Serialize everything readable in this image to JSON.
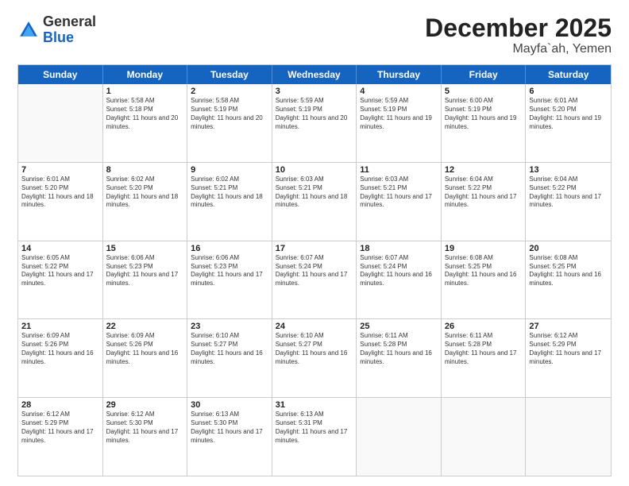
{
  "header": {
    "logo_general": "General",
    "logo_blue": "Blue",
    "month_title": "December 2025",
    "location": "Mayfa`ah, Yemen"
  },
  "calendar": {
    "days_of_week": [
      "Sunday",
      "Monday",
      "Tuesday",
      "Wednesday",
      "Thursday",
      "Friday",
      "Saturday"
    ],
    "rows": [
      [
        {
          "day": "",
          "sunrise": "",
          "sunset": "",
          "daylight": ""
        },
        {
          "day": "1",
          "sunrise": "Sunrise: 5:58 AM",
          "sunset": "Sunset: 5:18 PM",
          "daylight": "Daylight: 11 hours and 20 minutes."
        },
        {
          "day": "2",
          "sunrise": "Sunrise: 5:58 AM",
          "sunset": "Sunset: 5:19 PM",
          "daylight": "Daylight: 11 hours and 20 minutes."
        },
        {
          "day": "3",
          "sunrise": "Sunrise: 5:59 AM",
          "sunset": "Sunset: 5:19 PM",
          "daylight": "Daylight: 11 hours and 20 minutes."
        },
        {
          "day": "4",
          "sunrise": "Sunrise: 5:59 AM",
          "sunset": "Sunset: 5:19 PM",
          "daylight": "Daylight: 11 hours and 19 minutes."
        },
        {
          "day": "5",
          "sunrise": "Sunrise: 6:00 AM",
          "sunset": "Sunset: 5:19 PM",
          "daylight": "Daylight: 11 hours and 19 minutes."
        },
        {
          "day": "6",
          "sunrise": "Sunrise: 6:01 AM",
          "sunset": "Sunset: 5:20 PM",
          "daylight": "Daylight: 11 hours and 19 minutes."
        }
      ],
      [
        {
          "day": "7",
          "sunrise": "Sunrise: 6:01 AM",
          "sunset": "Sunset: 5:20 PM",
          "daylight": "Daylight: 11 hours and 18 minutes."
        },
        {
          "day": "8",
          "sunrise": "Sunrise: 6:02 AM",
          "sunset": "Sunset: 5:20 PM",
          "daylight": "Daylight: 11 hours and 18 minutes."
        },
        {
          "day": "9",
          "sunrise": "Sunrise: 6:02 AM",
          "sunset": "Sunset: 5:21 PM",
          "daylight": "Daylight: 11 hours and 18 minutes."
        },
        {
          "day": "10",
          "sunrise": "Sunrise: 6:03 AM",
          "sunset": "Sunset: 5:21 PM",
          "daylight": "Daylight: 11 hours and 18 minutes."
        },
        {
          "day": "11",
          "sunrise": "Sunrise: 6:03 AM",
          "sunset": "Sunset: 5:21 PM",
          "daylight": "Daylight: 11 hours and 17 minutes."
        },
        {
          "day": "12",
          "sunrise": "Sunrise: 6:04 AM",
          "sunset": "Sunset: 5:22 PM",
          "daylight": "Daylight: 11 hours and 17 minutes."
        },
        {
          "day": "13",
          "sunrise": "Sunrise: 6:04 AM",
          "sunset": "Sunset: 5:22 PM",
          "daylight": "Daylight: 11 hours and 17 minutes."
        }
      ],
      [
        {
          "day": "14",
          "sunrise": "Sunrise: 6:05 AM",
          "sunset": "Sunset: 5:22 PM",
          "daylight": "Daylight: 11 hours and 17 minutes."
        },
        {
          "day": "15",
          "sunrise": "Sunrise: 6:06 AM",
          "sunset": "Sunset: 5:23 PM",
          "daylight": "Daylight: 11 hours and 17 minutes."
        },
        {
          "day": "16",
          "sunrise": "Sunrise: 6:06 AM",
          "sunset": "Sunset: 5:23 PM",
          "daylight": "Daylight: 11 hours and 17 minutes."
        },
        {
          "day": "17",
          "sunrise": "Sunrise: 6:07 AM",
          "sunset": "Sunset: 5:24 PM",
          "daylight": "Daylight: 11 hours and 17 minutes."
        },
        {
          "day": "18",
          "sunrise": "Sunrise: 6:07 AM",
          "sunset": "Sunset: 5:24 PM",
          "daylight": "Daylight: 11 hours and 16 minutes."
        },
        {
          "day": "19",
          "sunrise": "Sunrise: 6:08 AM",
          "sunset": "Sunset: 5:25 PM",
          "daylight": "Daylight: 11 hours and 16 minutes."
        },
        {
          "day": "20",
          "sunrise": "Sunrise: 6:08 AM",
          "sunset": "Sunset: 5:25 PM",
          "daylight": "Daylight: 11 hours and 16 minutes."
        }
      ],
      [
        {
          "day": "21",
          "sunrise": "Sunrise: 6:09 AM",
          "sunset": "Sunset: 5:26 PM",
          "daylight": "Daylight: 11 hours and 16 minutes."
        },
        {
          "day": "22",
          "sunrise": "Sunrise: 6:09 AM",
          "sunset": "Sunset: 5:26 PM",
          "daylight": "Daylight: 11 hours and 16 minutes."
        },
        {
          "day": "23",
          "sunrise": "Sunrise: 6:10 AM",
          "sunset": "Sunset: 5:27 PM",
          "daylight": "Daylight: 11 hours and 16 minutes."
        },
        {
          "day": "24",
          "sunrise": "Sunrise: 6:10 AM",
          "sunset": "Sunset: 5:27 PM",
          "daylight": "Daylight: 11 hours and 16 minutes."
        },
        {
          "day": "25",
          "sunrise": "Sunrise: 6:11 AM",
          "sunset": "Sunset: 5:28 PM",
          "daylight": "Daylight: 11 hours and 16 minutes."
        },
        {
          "day": "26",
          "sunrise": "Sunrise: 6:11 AM",
          "sunset": "Sunset: 5:28 PM",
          "daylight": "Daylight: 11 hours and 17 minutes."
        },
        {
          "day": "27",
          "sunrise": "Sunrise: 6:12 AM",
          "sunset": "Sunset: 5:29 PM",
          "daylight": "Daylight: 11 hours and 17 minutes."
        }
      ],
      [
        {
          "day": "28",
          "sunrise": "Sunrise: 6:12 AM",
          "sunset": "Sunset: 5:29 PM",
          "daylight": "Daylight: 11 hours and 17 minutes."
        },
        {
          "day": "29",
          "sunrise": "Sunrise: 6:12 AM",
          "sunset": "Sunset: 5:30 PM",
          "daylight": "Daylight: 11 hours and 17 minutes."
        },
        {
          "day": "30",
          "sunrise": "Sunrise: 6:13 AM",
          "sunset": "Sunset: 5:30 PM",
          "daylight": "Daylight: 11 hours and 17 minutes."
        },
        {
          "day": "31",
          "sunrise": "Sunrise: 6:13 AM",
          "sunset": "Sunset: 5:31 PM",
          "daylight": "Daylight: 11 hours and 17 minutes."
        },
        {
          "day": "",
          "sunrise": "",
          "sunset": "",
          "daylight": ""
        },
        {
          "day": "",
          "sunrise": "",
          "sunset": "",
          "daylight": ""
        },
        {
          "day": "",
          "sunrise": "",
          "sunset": "",
          "daylight": ""
        }
      ]
    ]
  }
}
